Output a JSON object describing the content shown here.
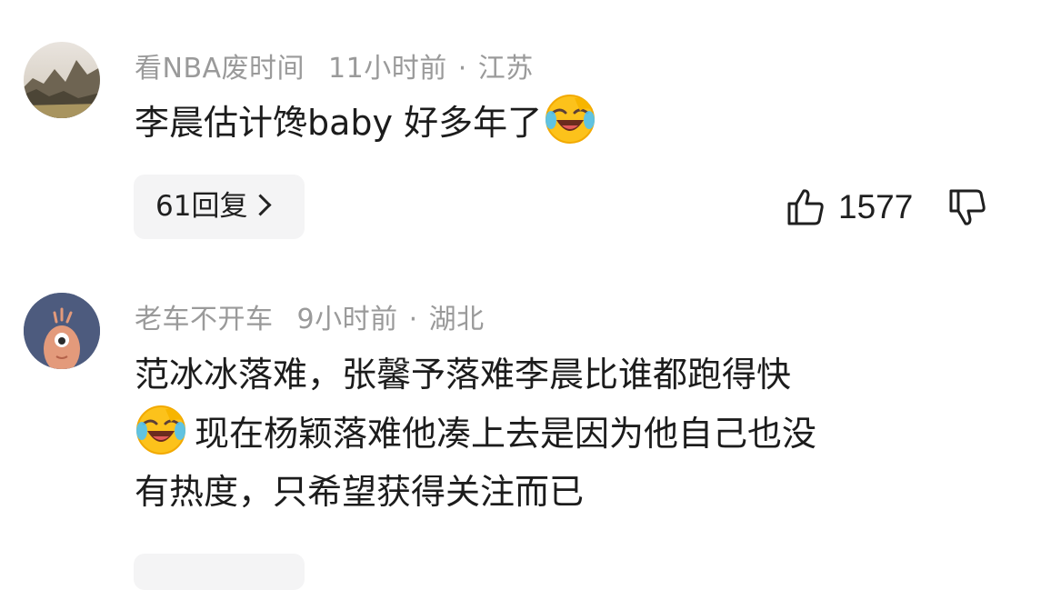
{
  "comments": [
    {
      "username": "看NBA废时间",
      "time": "11小时前",
      "separator": "·",
      "location": "江苏",
      "text_lines": [
        "李晨估计馋baby 好多年了"
      ],
      "emoji": "face-with-tears-of-joy",
      "reply_label": "61回复",
      "like_count": "1577"
    },
    {
      "username": "老车不开车",
      "time": "9小时前",
      "separator": "·",
      "location": "湖北",
      "text_lines": [
        "范冰冰落难，张馨予落难李晨比谁都跑得快",
        "现在杨颖落难他凑上去是因为他自己也没",
        "有热度，只希望获得关注而已"
      ],
      "emoji": "face-with-tears-of-joy"
    }
  ]
}
